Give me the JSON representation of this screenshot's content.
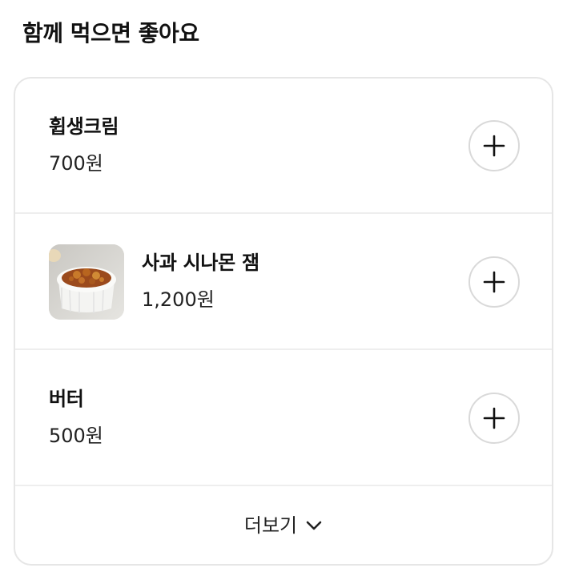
{
  "section": {
    "title": "함께 먹으면 좋아요"
  },
  "items": [
    {
      "name": "휩생크림",
      "price": "700원",
      "image": null
    },
    {
      "name": "사과 시나몬 잼",
      "price": "1,200원",
      "image": "apple-cinnamon-jam-photo"
    },
    {
      "name": "버터",
      "price": "500원",
      "image": null
    }
  ],
  "icons": {
    "add": "plus-icon",
    "more": "chevron-down-icon"
  },
  "more": {
    "label": "더보기"
  }
}
